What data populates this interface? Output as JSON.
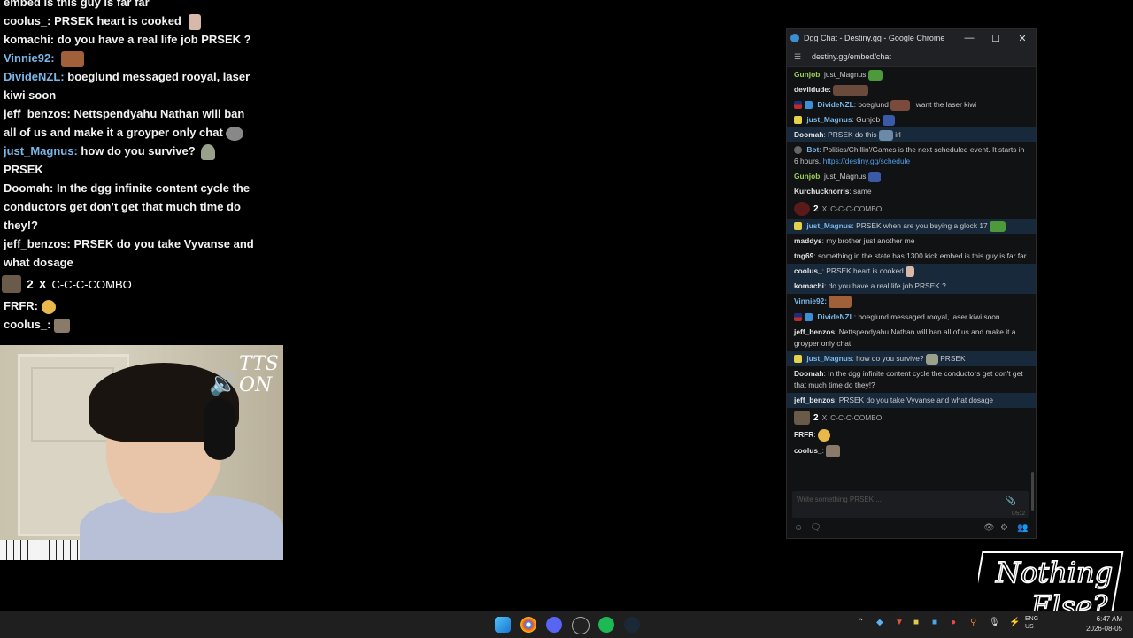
{
  "overlay": {
    "top_fragment": "embed is this guy is far far",
    "lines": [
      {
        "user": "coolus_:",
        "text": "PRSEK heart is cooked",
        "emote": "biden-face",
        "blue": false
      },
      {
        "user": "komachi:",
        "text": "do you have a real life job PRSEK ?",
        "blue": false
      },
      {
        "user": "Vinnie92:",
        "text": "",
        "emote": "photo-emote",
        "blue": true
      },
      {
        "user": "DivideNZL:",
        "text": "boeglund messaged rooyal, laser kiwi soon",
        "blue": true
      },
      {
        "user": "jeff_benzos:",
        "text": "Nettspendyahu Nathan will ban all of us and make it a groyper only chat",
        "emote": "cat-emote",
        "blue": false
      },
      {
        "user": "just_Magnus:",
        "text": "how do you survive?",
        "emote": "ghost-emote",
        "trail": "PRSEK",
        "blue": true
      },
      {
        "user": "Doomah:",
        "text": "In the dgg infinite content cycle the conductors get don’t get that much time do they!?",
        "blue": false
      },
      {
        "user": "jeff_benzos:",
        "text": "PRSEK do you take Vyvanse and what dosage",
        "blue": false
      }
    ],
    "combo": {
      "count": "2",
      "x": "X",
      "label": "C-C-C-COMBO"
    },
    "frfr": {
      "user": "FRFR:"
    },
    "last": {
      "user": "coolus_:"
    }
  },
  "tts": {
    "icon": "speaker-icon",
    "text": "TTS ON"
  },
  "window": {
    "title": "Dgg Chat - Destiny.gg - Google Chrome",
    "url": "destiny.gg/embed/chat",
    "controls": [
      "—",
      "☐",
      "✕"
    ]
  },
  "chat": {
    "messages": [
      {
        "user": "Gunjob",
        "text": ": just_Magnus",
        "color": "g",
        "flair": "",
        "hl": false
      },
      {
        "user": "devildude:",
        "text": "",
        "color": "",
        "flair": "",
        "hl": false
      },
      {
        "user": "DivideNZL",
        "text": ": boeglund",
        "trail": "i want the laser kiwi",
        "color": "blue",
        "flair": "flag",
        "hl": false
      },
      {
        "user": "just_Magnus",
        "text": ": Gunjob",
        "color": "blue",
        "flair": "yellow",
        "hl": false
      },
      {
        "user": "Doomah",
        "text": ": PRSEK do this",
        "trail": "irl",
        "color": "",
        "flair": "",
        "hl": true
      },
      {
        "user": "Bot",
        "text": ": Politics/Chillin'/Games is the next scheduled event. It starts in 6 hours. ",
        "link": "https://destiny.gg/schedule",
        "color": "blue",
        "flair": "bot",
        "hl": false
      },
      {
        "user": "Gunjob",
        "text": ": just_Magnus",
        "color": "g",
        "flair": "",
        "hl": false
      },
      {
        "user": "Kurchucknorris",
        "text": ": same",
        "color": "",
        "flair": "",
        "hl": false
      }
    ],
    "combo1": {
      "count": "2",
      "x": "X",
      "label": "C-C-C-COMBO"
    },
    "messages2": [
      {
        "user": "just_Magnus",
        "text": ": PRSEK when are you buying a glock 17",
        "color": "blue",
        "flair": "yellow",
        "hl": true
      },
      {
        "user": "maddys",
        "text": ": my brother just another me",
        "color": "",
        "flair": "",
        "hl": false
      },
      {
        "user": "tng69",
        "text": ": something in the state has 1300 kick embed is this guy is far far",
        "color": "",
        "flair": "",
        "hl": false
      },
      {
        "user": "coolus_",
        "text": ": PRSEK heart is cooked",
        "color": "",
        "flair": "",
        "hl": true
      },
      {
        "user": "komachi",
        "text": ": do you have a real life job PRSEK ?",
        "color": "",
        "flair": "",
        "hl": true
      },
      {
        "user": "Vinnie92:",
        "text": "",
        "color": "blue",
        "flair": "",
        "hl": false
      },
      {
        "user": "DivideNZL",
        "text": ": boeglund messaged rooyal, laser kiwi soon",
        "color": "blue",
        "flair": "flag",
        "hl": false
      },
      {
        "user": "jeff_benzos",
        "text": ": Nettspendyahu Nathan will ban all of us and make it a groyper only chat",
        "color": "",
        "flair": "",
        "hl": false
      },
      {
        "user": "just_Magnus",
        "text": ": how do you survive?",
        "trail": "PRSEK",
        "color": "blue",
        "flair": "yellow",
        "hl": true
      },
      {
        "user": "Doomah",
        "text": ": In the dgg infinite content cycle the conductors get don't get that much time do they!?",
        "color": "",
        "flair": "",
        "hl": false
      },
      {
        "user": "jeff_benzos",
        "text": ": PRSEK do you take Vyvanse and what dosage",
        "color": "",
        "flair": "",
        "hl": true
      }
    ],
    "combo2": {
      "count": "2",
      "x": "X",
      "label": "C-C-C-COMBO"
    },
    "messages3": [
      {
        "user": "FRFR",
        "text": ":",
        "color": "",
        "flair": ""
      },
      {
        "user": "coolus_",
        "text": ":",
        "color": "",
        "flair": ""
      }
    ],
    "input_placeholder": "Write something PRSEK ...",
    "char_count": "0/512"
  },
  "watermark": {
    "line1": "Nothing",
    "line2": "Else?"
  },
  "taskbar": {
    "lang": "ENG",
    "region": "US",
    "time": "6:47 AM",
    "date": "2026-08-05"
  }
}
